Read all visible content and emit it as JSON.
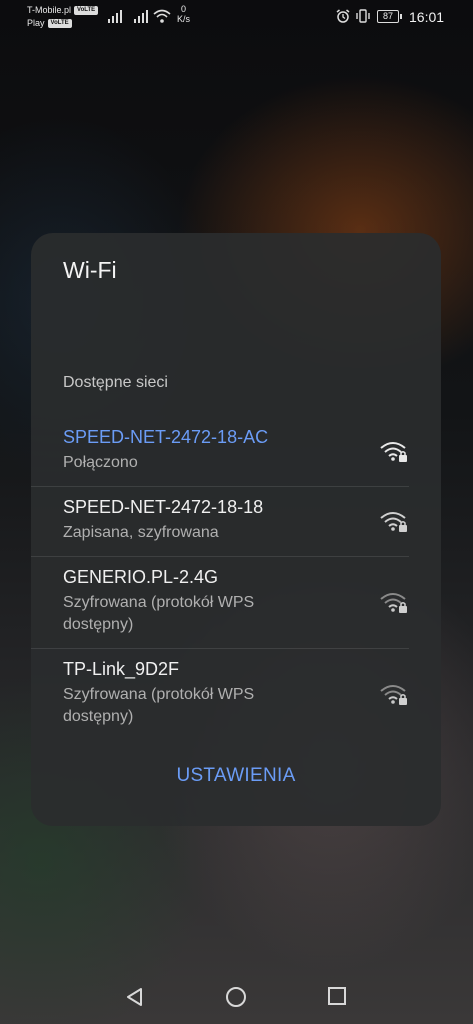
{
  "status_bar": {
    "carrier1": "T-Mobile.pl",
    "carrier2": "Play",
    "volte": "VoLTE",
    "speed_value": "0",
    "speed_unit": "K/s",
    "battery": "87",
    "time": "16:01"
  },
  "dialog": {
    "title": "Wi-Fi",
    "section_label": "Dostępne sieci",
    "networks": [
      {
        "name": "SPEED-NET-2472-18-AC",
        "status": "Połączono",
        "connected": true
      },
      {
        "name": "SPEED-NET-2472-18-18",
        "status": "Zapisana, szyfrowana",
        "connected": false
      },
      {
        "name": "GENERIO.PL-2.4G",
        "status": "Szyfrowana (protokół WPS dostępny)",
        "connected": false
      },
      {
        "name": "TP-Link_9D2F",
        "status": "Szyfrowana (protokół WPS dostępny)",
        "connected": false
      }
    ],
    "settings_label": "USTAWIENIA"
  },
  "colors": {
    "accent": "#6b9cf6",
    "dialog_bg": "#2a2c2e"
  },
  "nav_bar": {
    "back_icon": "back-triangle-icon",
    "home_icon": "home-circle-icon",
    "recents_icon": "recents-square-icon"
  }
}
